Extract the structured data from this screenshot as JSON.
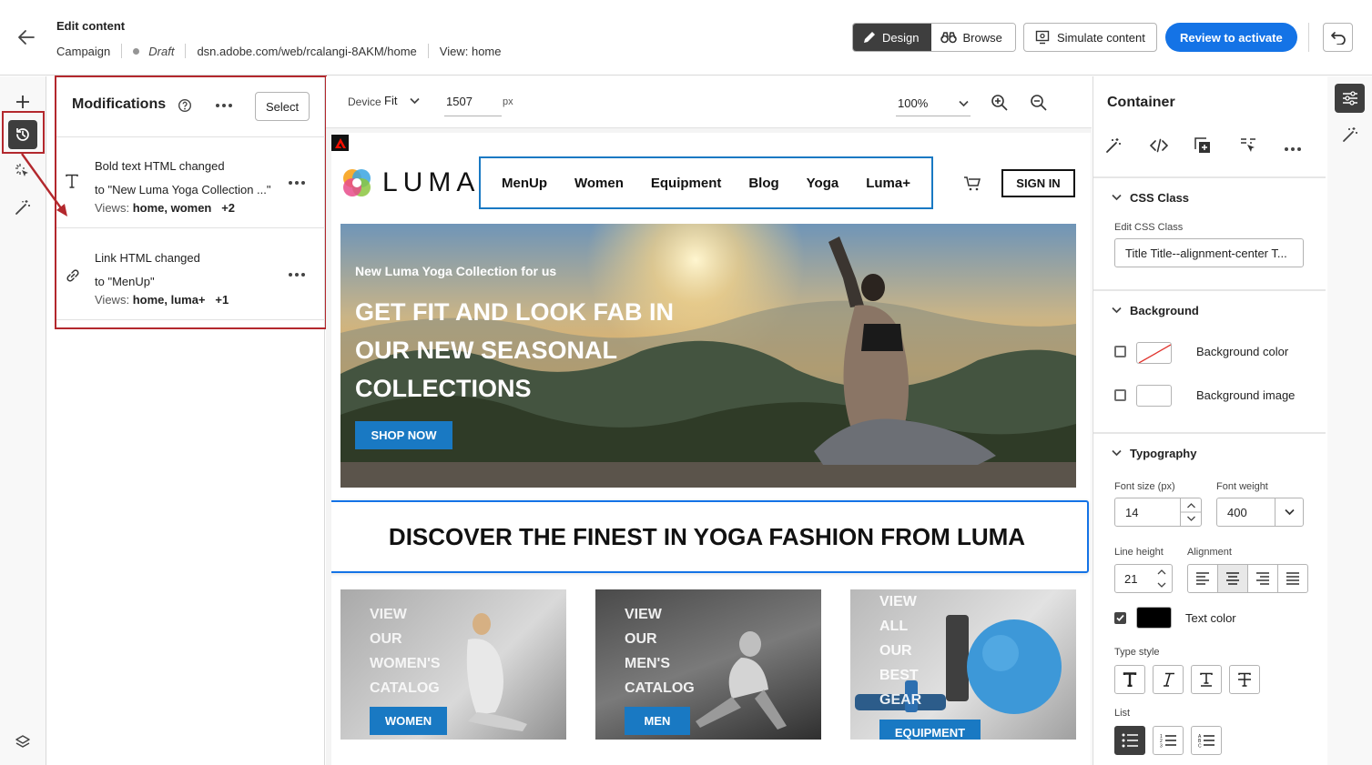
{
  "header": {
    "title": "Edit content",
    "type": "Campaign",
    "status": "Draft",
    "url": "dsn.adobe.com/web/rcalangi-8AKM/home",
    "view": "View: home",
    "design_label": "Design",
    "browse_label": "Browse",
    "simulate_label": "Simulate content",
    "review_label": "Review to activate"
  },
  "modifications": {
    "title": "Modifications",
    "select_label": "Select",
    "items": [
      {
        "title": "Bold text HTML changed",
        "detail": "to \"New Luma Yoga Collection ...\"",
        "views_label": "Views:",
        "views": "home, women",
        "extra": "+2",
        "icon": "text-icon"
      },
      {
        "title": "Link HTML changed",
        "detail": "to \"MenUp\"",
        "views_label": "Views:",
        "views": "home, luma+",
        "extra": "+1",
        "icon": "link-icon"
      }
    ]
  },
  "toolbar": {
    "device_label": "Device",
    "device_value": "Fit",
    "width_value": "1507",
    "unit": "px",
    "zoom": "100%"
  },
  "site": {
    "logo_text": "LUMA",
    "nav": [
      "MenUp",
      "Women",
      "Equipment",
      "Blog",
      "Yoga",
      "Luma+"
    ],
    "sign_in": "SIGN IN",
    "hero_subtitle": "New Luma Yoga Collection for us",
    "hero_title_lines": [
      "GET FIT AND LOOK FAB IN",
      "OUR NEW SEASONAL",
      "COLLECTIONS"
    ],
    "hero_cta": "SHOP NOW",
    "banner_title": "DISCOVER THE FINEST IN YOGA FASHION FROM LUMA",
    "cards": [
      {
        "lines": [
          "VIEW",
          "OUR",
          "WOMEN'S",
          "CATALOG"
        ],
        "button": "WOMEN"
      },
      {
        "lines": [
          "VIEW",
          "OUR",
          "MEN'S",
          "CATALOG"
        ],
        "button": "MEN"
      },
      {
        "lines": [
          "VIEW",
          "ALL",
          "OUR",
          "BEST",
          "GEAR"
        ],
        "button": "EQUIPMENT"
      }
    ]
  },
  "properties": {
    "title": "Container",
    "css_section": "CSS Class",
    "css_label": "Edit CSS Class",
    "css_value": "Title Title--alignment-center T...",
    "background_section": "Background",
    "bg_color_label": "Background color",
    "bg_image_label": "Background image",
    "typography_section": "Typography",
    "font_size_label": "Font size (px)",
    "font_size_value": "14",
    "font_weight_label": "Font weight",
    "font_weight_value": "400",
    "line_height_label": "Line height",
    "line_height_value": "21",
    "alignment_label": "Alignment",
    "text_color_label": "Text color",
    "text_color_value": "#000000",
    "type_style_label": "Type style",
    "list_label": "List"
  },
  "colors": {
    "accent": "#1473e6",
    "site_blue": "#1979c3",
    "highlight_red": "#b3282d"
  }
}
